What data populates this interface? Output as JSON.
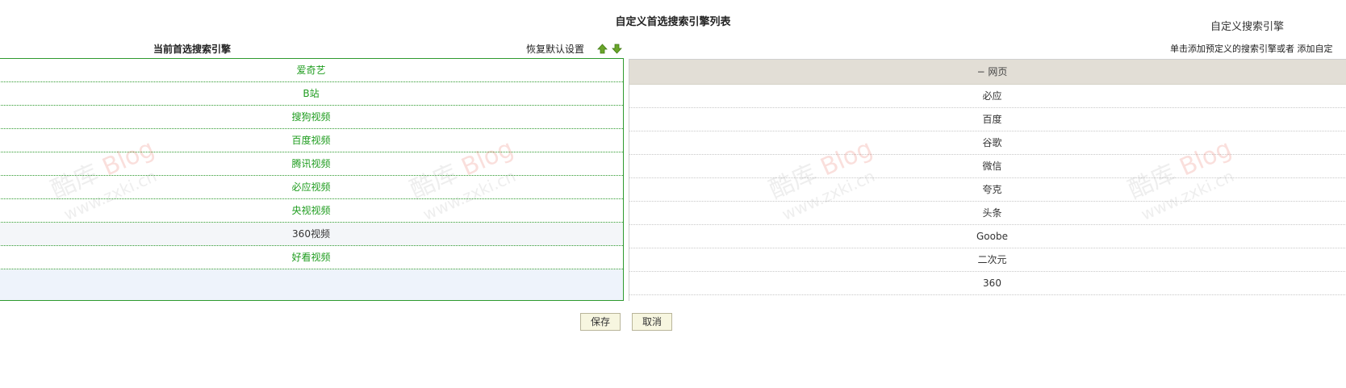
{
  "page": {
    "title": "自定义首选搜索引擎列表",
    "right_title": "自定义搜索引擎"
  },
  "left": {
    "heading": "当前首选搜索引擎",
    "restore_label": "恢复默认设置",
    "items": [
      "爱奇艺",
      "B站",
      "搜狗视频",
      "百度视频",
      "腾讯视频",
      "必应视频",
      "央视视频",
      "360视频",
      "好看视频"
    ]
  },
  "right": {
    "instruction": "单击添加预定义的搜索引擎或者 添加自定",
    "group_label": "− 网页",
    "items": [
      "必应",
      "百度",
      "谷歌",
      "微信",
      "夸克",
      "头条",
      "Goobe",
      "二次元",
      "360"
    ]
  },
  "buttons": {
    "save": "保存",
    "cancel": "取消"
  },
  "watermark": {
    "brand": "酷库",
    "blog": "Blog",
    "url": "www.zxki.cn"
  },
  "colors": {
    "accent_green": "#1e9c1e",
    "border_green": "#2e9a2e",
    "header_bg": "#e2ded6",
    "button_bg": "#f7f6e0"
  }
}
